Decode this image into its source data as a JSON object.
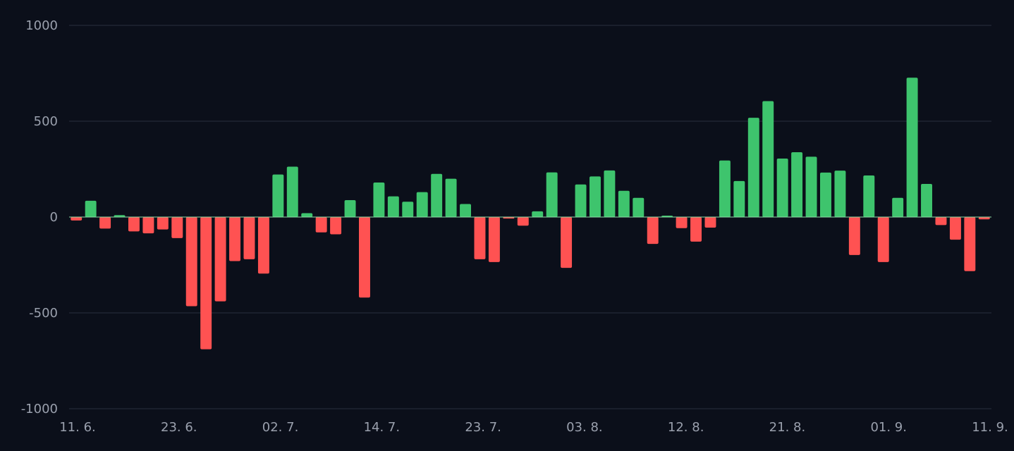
{
  "chart_data": {
    "type": "bar",
    "title": "",
    "xlabel": "",
    "ylabel": "",
    "ylim": [
      -1000,
      1000
    ],
    "y_ticks": [
      "1000",
      "500",
      "0",
      "-500",
      "-1000"
    ],
    "x_tick_labels": [
      "11. 6.",
      "23. 6.",
      "02. 7.",
      "14. 7.",
      "23. 7.",
      "03. 8.",
      "12. 8.",
      "21. 8.",
      "01. 9.",
      "11. 9."
    ],
    "grid": true,
    "legend": "none",
    "colors": {
      "positive": "#3ec46d",
      "negative": "#ff5252",
      "background": "#0b0f1a",
      "grid": "#2a2f3d",
      "tick_text": "#9aa0ad"
    },
    "values": [
      -18,
      85,
      -60,
      10,
      -75,
      -85,
      -65,
      -110,
      -465,
      -690,
      -440,
      -230,
      -220,
      -295,
      222,
      263,
      20,
      -80,
      -90,
      88,
      -420,
      180,
      108,
      80,
      130,
      225,
      200,
      68,
      -220,
      -235,
      -8,
      -45,
      30,
      233,
      -265,
      170,
      212,
      243,
      137,
      100,
      -140,
      5,
      -58,
      -128,
      -55,
      295,
      188,
      518,
      605,
      305,
      338,
      315,
      232,
      242,
      -198,
      217,
      -235,
      100,
      727,
      173,
      -42,
      -118,
      -282,
      -12
    ]
  }
}
